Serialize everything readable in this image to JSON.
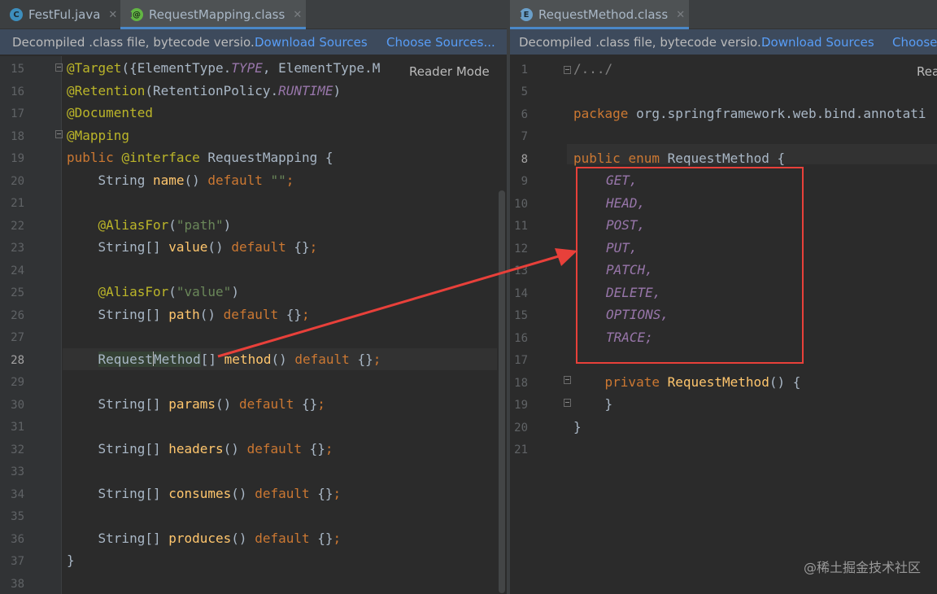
{
  "left": {
    "tabs": [
      {
        "label": "FestFul.java",
        "icon": "class-icon"
      },
      {
        "label": "RequestMapping.class",
        "icon": "annotation-icon"
      }
    ],
    "info": {
      "message": "Decompiled .class file, bytecode versio...",
      "download": "Download Sources",
      "choose": "Choose Sources..."
    },
    "reader_mode": "Reader Mode",
    "line_numbers": [
      "15",
      "16",
      "17",
      "18",
      "19",
      "20",
      "21",
      "22",
      "23",
      "24",
      "25",
      "26",
      "27",
      "28",
      "29",
      "30",
      "31",
      "32",
      "33",
      "34",
      "35",
      "36",
      "37",
      "38"
    ],
    "code": {
      "l15a": "@Target",
      "l15b": "({ElementType.",
      "l15c": "TYPE",
      "l15d": ", ElementType.M",
      "l16a": "@Retention",
      "l16b": "(RetentionPolicy.",
      "l16c": "RUNTIME",
      "l16d": ")",
      "l17": "@Documented",
      "l18": "@Mapping",
      "l19a": "public ",
      "l19b": "@interface ",
      "l19c": "RequestMapping",
      "l19d": " {",
      "l20a": "    String ",
      "l20b": "name",
      "l20c": "() ",
      "l20d": "default ",
      "l20e": "\"\"",
      "l20f": ";",
      "l22a": "    @AliasFor",
      "l22b": "(",
      "l22c": "\"path\"",
      "l22d": ")",
      "l23a": "    String[] ",
      "l23b": "value",
      "l23c": "() ",
      "l23d": "default ",
      "l23e": "{}",
      "l23f": ";",
      "l25a": "    @AliasFor",
      "l25b": "(",
      "l25c": "\"value\"",
      "l25d": ")",
      "l26a": "    String[] ",
      "l26b": "path",
      "l26c": "() ",
      "l26d": "default ",
      "l26e": "{}",
      "l26f": ";",
      "l28pre": "    ",
      "l28a": "Request",
      "l28b": "Method",
      "l28c": "[] ",
      "l28d": "method",
      "l28e": "() ",
      "l28f": "default ",
      "l28g": "{}",
      "l28h": ";",
      "l30a": "    String[] ",
      "l30b": "params",
      "l30c": "() ",
      "l30d": "default ",
      "l30e": "{}",
      "l30f": ";",
      "l32a": "    String[] ",
      "l32b": "headers",
      "l32c": "() ",
      "l32d": "default ",
      "l32e": "{}",
      "l32f": ";",
      "l34a": "    String[] ",
      "l34b": "consumes",
      "l34c": "() ",
      "l34d": "default ",
      "l34e": "{}",
      "l34f": ";",
      "l36a": "    String[] ",
      "l36b": "produces",
      "l36c": "() ",
      "l36d": "default ",
      "l36e": "{}",
      "l36f": ";",
      "l37": "}"
    }
  },
  "right": {
    "tab": {
      "label": "RequestMethod.class",
      "icon": "enum-icon"
    },
    "info": {
      "message": "Decompiled .class file, bytecode versio...",
      "download": "Download Sources",
      "choose": "Choose"
    },
    "reader_mode": "Rea",
    "line_numbers": [
      "1",
      "5",
      "6",
      "7",
      "8",
      "9",
      "10",
      "11",
      "12",
      "13",
      "14",
      "15",
      "16",
      "17",
      "18",
      "19",
      "20",
      "21"
    ],
    "code": {
      "l1": "/.../",
      "l6a": "package ",
      "l6b": "org.springframework.web.bind.annotati",
      "l8a": "public ",
      "l8b": "enum ",
      "l8c": "RequestMethod",
      "l8d": " {",
      "values": [
        "GET,",
        "HEAD,",
        "POST,",
        "PUT,",
        "PATCH,",
        "DELETE,",
        "OPTIONS,",
        "TRACE;"
      ],
      "l18a": "    private ",
      "l18b": "RequestMethod",
      "l18c": "() {",
      "l19": "    }",
      "l20": "}"
    }
  },
  "watermark": "@稀土掘金技术社区",
  "colors": {
    "highlight_box": "#e8403a",
    "arrow": "#e8403a",
    "link": "#589df6"
  }
}
